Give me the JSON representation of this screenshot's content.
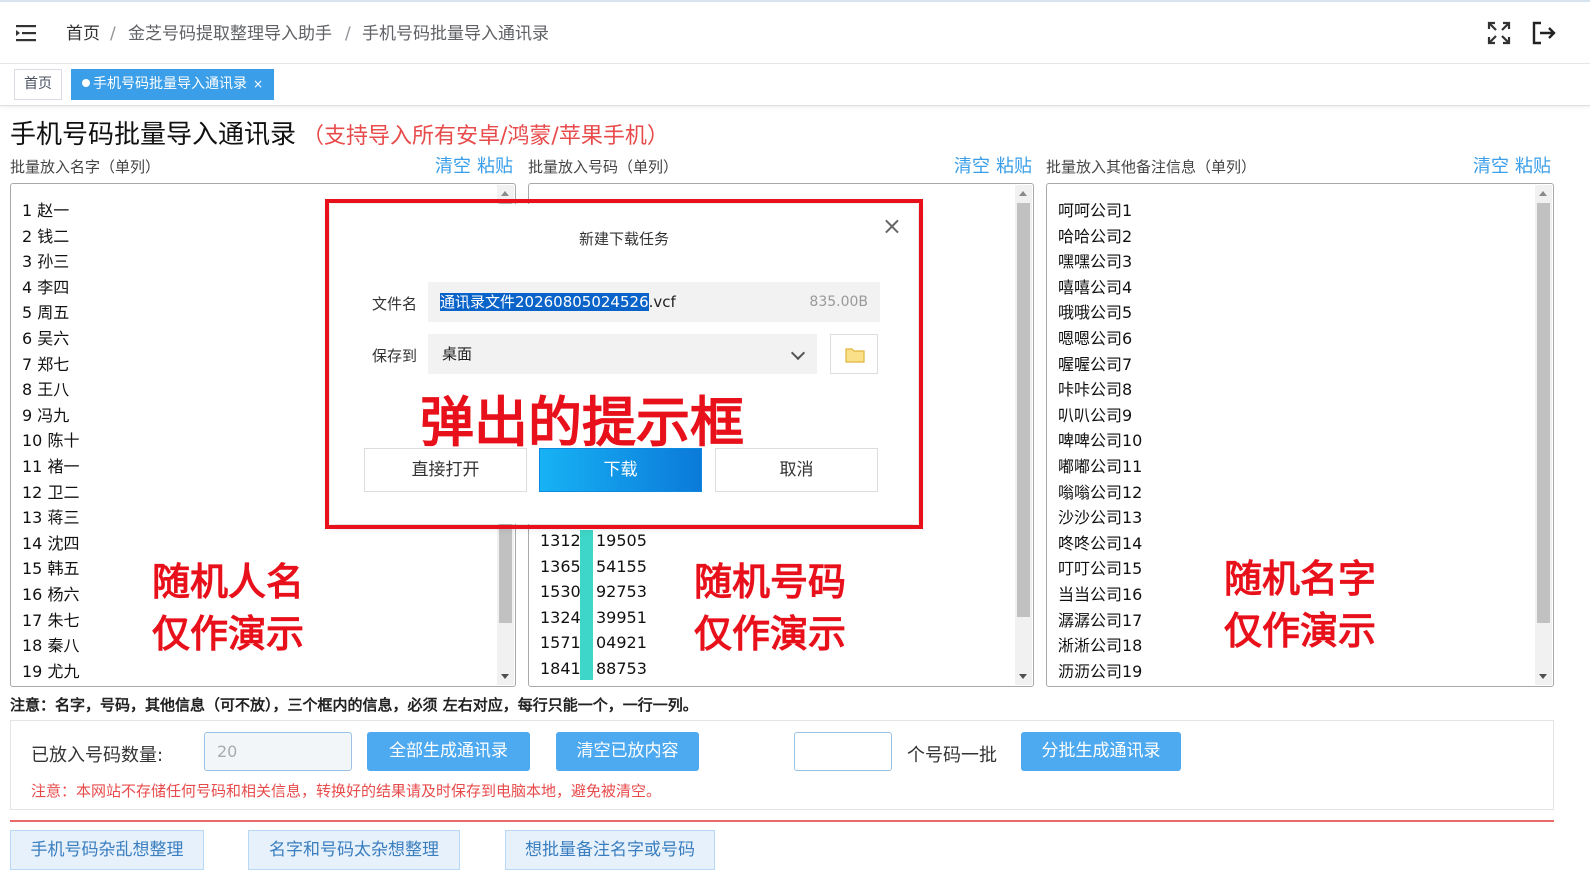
{
  "header": {
    "breadcrumb": [
      "首页",
      "金芝号码提取整理导入助手",
      "手机号码批量导入通讯录"
    ],
    "separator": "/",
    "icons": [
      "menu-fold-icon",
      "fullscreen-icon",
      "logout-icon"
    ]
  },
  "tags": {
    "home": "首页",
    "active": "手机号码批量导入通讯录",
    "close": "×"
  },
  "page": {
    "title": "手机号码批量导入通讯录",
    "subtitle": "（支持导入所有安卓/鸿蒙/苹果手机）"
  },
  "columns": [
    {
      "label": "批量放入名字（单列）",
      "clear": "清空",
      "paste": "粘贴"
    },
    {
      "label": "批量放入号码（单列）",
      "clear": "清空",
      "paste": "粘贴"
    },
    {
      "label": "批量放入其他备注信息（单列）",
      "clear": "清空",
      "paste": "粘贴"
    }
  ],
  "names_text": "1 赵一\n2 钱二\n3 孙三\n4 李四\n5 周五\n6 吴六\n7 郑七\n8 王八\n9 冯九\n10 陈十\n11 褚一\n12 卫二\n13 蒋三\n14 沈四\n15 韩五\n16 杨六\n17 朱七\n18 秦八\n19 尤九",
  "phones_text": "13126 19505\n13651 54155\n15301 92753\n13240 39951\n15711 04921\n18411 88753",
  "notes_text": "呵呵公司1\n哈哈公司2\n嘿嘿公司3\n嘻嘻公司4\n哦哦公司5\n嗯嗯公司6\n喔喔公司7\n咔咔公司8\n叭叭公司9\n啤啤公司10\n嘟嘟公司11\n嗡嗡公司12\n沙沙公司13\n咚咚公司14\n叮叮公司15\n当当公司16\n潺潺公司17\n淅淅公司18\n沥沥公司19",
  "annotations": {
    "names": "随机人名\n仅作演示",
    "phones": "随机号码\n仅作演示",
    "notes": "随机名字\n仅作演示",
    "popup": "弹出的提示框"
  },
  "note_line": "注意：名字，号码，其他信息（可不放），三个框内的信息，必须 左右对应，每行只能一个，一行一列。",
  "controls": {
    "count_label": "已放入号码数量:",
    "count_value": "20",
    "generate_all": "全部生成通讯录",
    "clear_all": "清空已放内容",
    "batch_size_value": "",
    "batch_suffix": "个号码一批",
    "batch_generate": "分批生成通讯录",
    "warning": "注意：本网站不存储任何号码和相关信息，转换好的结果请及时保存到电脑本地，避免被清空。"
  },
  "footer_buttons": [
    "手机号码杂乱想整理",
    "名字和号码太杂想整理",
    "想批量备注名字或号码"
  ],
  "dialog": {
    "title": "新建下载任务",
    "close": "×",
    "filename_label": "文件名",
    "filename_selected": "通讯录文件20260805024526",
    "filename_ext": ".vcf",
    "file_size": "835.00B",
    "saveto_label": "保存到",
    "saveto_value": "桌面",
    "link_text": "",
    "open_button": "直接打开",
    "download_button": "下载",
    "cancel_button": "取消"
  },
  "colors": {
    "accent": "#3a9ee8",
    "warning": "#e84b4b",
    "annotation": "#e8101a",
    "cyan_mark": "#3dd6c8"
  }
}
